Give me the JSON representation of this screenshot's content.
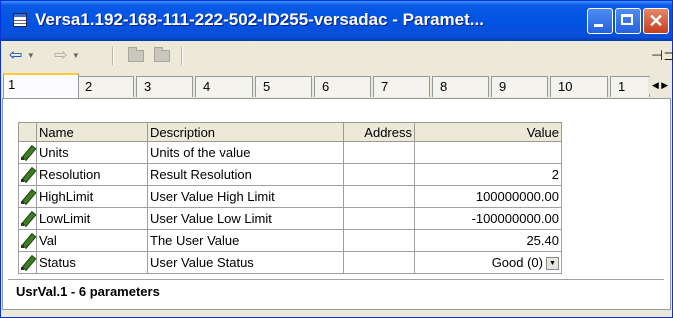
{
  "window": {
    "title": "Versa1.192-168-111-222-502-ID255-versadac - Paramet...",
    "minimize_icon": "minimize-icon",
    "maximize_icon": "maximize-icon",
    "close_icon": "close-icon"
  },
  "toolbar": {
    "back_icon": "back-arrow-icon",
    "forward_icon": "forward-arrow-icon",
    "pin_icon": "pin-icon"
  },
  "tabs": [
    "1",
    "2",
    "3",
    "4",
    "5",
    "6",
    "7",
    "8",
    "9",
    "10",
    "1"
  ],
  "table": {
    "columns": [
      "Name",
      "Description",
      "Address",
      "Value"
    ],
    "rows": [
      {
        "name": "Units",
        "description": "Units of the value",
        "address": "",
        "value": ""
      },
      {
        "name": "Resolution",
        "description": "Result Resolution",
        "address": "",
        "value": "2"
      },
      {
        "name": "HighLimit",
        "description": "User Value High Limit",
        "address": "",
        "value": "100000000.00"
      },
      {
        "name": "LowLimit",
        "description": "User Value Low Limit",
        "address": "",
        "value": "-100000000.00"
      },
      {
        "name": "Val",
        "description": "The User Value",
        "address": "",
        "value": "25.40"
      },
      {
        "name": "Status",
        "description": "User Value Status",
        "address": "",
        "value": "Good (0)"
      }
    ]
  },
  "status": {
    "text": "UsrVal.1  -  6 parameters"
  }
}
